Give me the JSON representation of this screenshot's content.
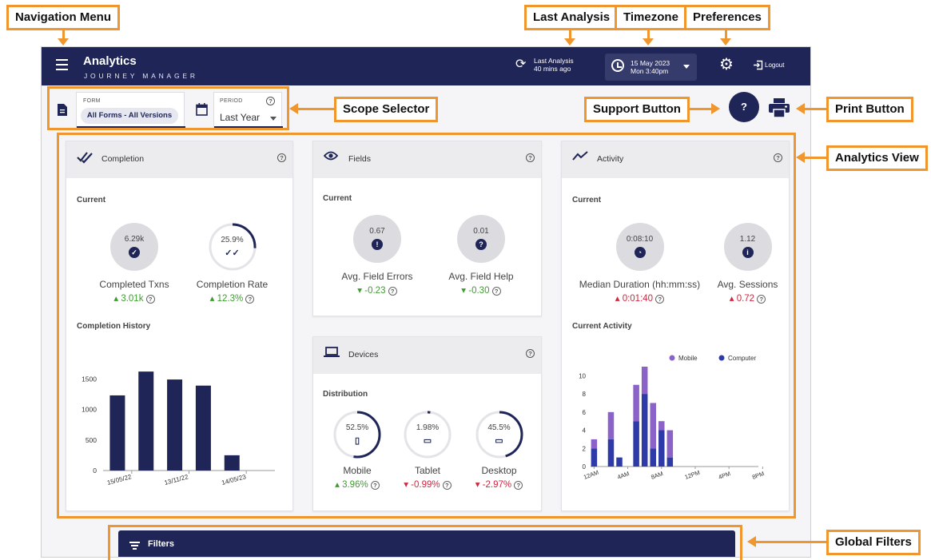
{
  "callouts": {
    "navigation_menu": "Navigation Menu",
    "last_analysis": "Last Analysis",
    "timezone": "Timezone",
    "preferences": "Preferences",
    "scope_selector": "Scope Selector",
    "support_button": "Support Button",
    "print_button": "Print Button",
    "analytics_view": "Analytics View",
    "global_filters": "Global Filters"
  },
  "header": {
    "title": "Analytics",
    "subtitle": "JOURNEY MANAGER",
    "last_analysis_line1": "Last Analysis",
    "last_analysis_line2": "40 mins ago",
    "date": "15 May 2023",
    "time": "Mon 3:40pm",
    "logout": "Logout"
  },
  "scope": {
    "form_label": "FORM",
    "form_value": "All Forms - All Versions",
    "period_label": "PERIOD",
    "period_value": "Last Year"
  },
  "support": {
    "label": "?"
  },
  "completion": {
    "title": "Completion",
    "current_label": "Current",
    "completed_value": "6.29k",
    "completed_label": "Completed Txns",
    "completed_delta": "3.01k",
    "rate_value": "25.9%",
    "rate_fraction": 0.259,
    "rate_label": "Completion Rate",
    "rate_delta": "12.3%",
    "history_label": "Completion History"
  },
  "fields": {
    "title": "Fields",
    "current_label": "Current",
    "errors_value": "0.67",
    "errors_label": "Avg. Field Errors",
    "errors_delta": "-0.23",
    "help_value": "0.01",
    "help_label": "Avg. Field Help",
    "help_delta": "-0.30"
  },
  "devices": {
    "title": "Devices",
    "distribution_label": "Distribution",
    "mobile_value": "52.5%",
    "mobile_fraction": 0.525,
    "mobile_label": "Mobile",
    "mobile_delta": "3.96%",
    "tablet_value": "1.98%",
    "tablet_fraction": 0.0198,
    "tablet_label": "Tablet",
    "tablet_delta": "-0.99%",
    "desktop_value": "45.5%",
    "desktop_fraction": 0.455,
    "desktop_label": "Desktop",
    "desktop_delta": "-2.97%"
  },
  "activity": {
    "title": "Activity",
    "current_label": "Current",
    "duration_value": "0:08:10",
    "duration_label": "Median Duration (hh:mm:ss)",
    "duration_delta": "0:01:40",
    "sessions_value": "1.12",
    "sessions_label": "Avg. Sessions",
    "sessions_delta": "0.72",
    "current_activity_label": "Current Activity"
  },
  "filters": {
    "label": "Filters"
  },
  "colors": {
    "navy": "#1f2557",
    "accent": "#f0962e",
    "mobile": "#8b62c7",
    "computer": "#2d3aa8",
    "up": "#3e9c2f",
    "down": "#d0263e"
  },
  "chart_data": [
    {
      "type": "bar",
      "title": "Completion History",
      "categories": [
        "15/05/22",
        "",
        "13/11/22",
        "",
        "14/05/23",
        ""
      ],
      "values": [
        1230,
        1620,
        1490,
        1390,
        250,
        0
      ],
      "x_tick_labels": [
        "15/05/22",
        "13/11/22",
        "14/05/23"
      ],
      "y_ticks": [
        "0",
        "500",
        "1000",
        "1500"
      ],
      "ylim": [
        0,
        1700
      ]
    },
    {
      "type": "bar",
      "title": "Current Activity",
      "stacked": true,
      "categories": [
        "12AM",
        "",
        "",
        "",
        "4AM",
        "",
        "",
        "",
        "8AM",
        "",
        "",
        "",
        "12PM",
        "",
        "",
        "",
        "4PM",
        "",
        "",
        "",
        "8PM",
        "",
        "",
        ""
      ],
      "x_tick_labels": [
        "12AM",
        "4AM",
        "8AM",
        "12PM",
        "4PM",
        "8PM"
      ],
      "y_ticks": [
        "0",
        "2",
        "4",
        "6",
        "8",
        "10"
      ],
      "ylim": [
        0,
        11
      ],
      "legend_position": "top-right",
      "series": [
        {
          "name": "Computer",
          "values": [
            2,
            0,
            3,
            1,
            0,
            5,
            8,
            2,
            4,
            1,
            0,
            0,
            0,
            0,
            0,
            0,
            0,
            0,
            0,
            0,
            0,
            0,
            0,
            0
          ]
        },
        {
          "name": "Mobile",
          "values": [
            1,
            0,
            3,
            0,
            0,
            4,
            3,
            5,
            1,
            3,
            0,
            0,
            0,
            0,
            0,
            0,
            0,
            0,
            0,
            0,
            0,
            0,
            0,
            0
          ]
        }
      ]
    }
  ]
}
